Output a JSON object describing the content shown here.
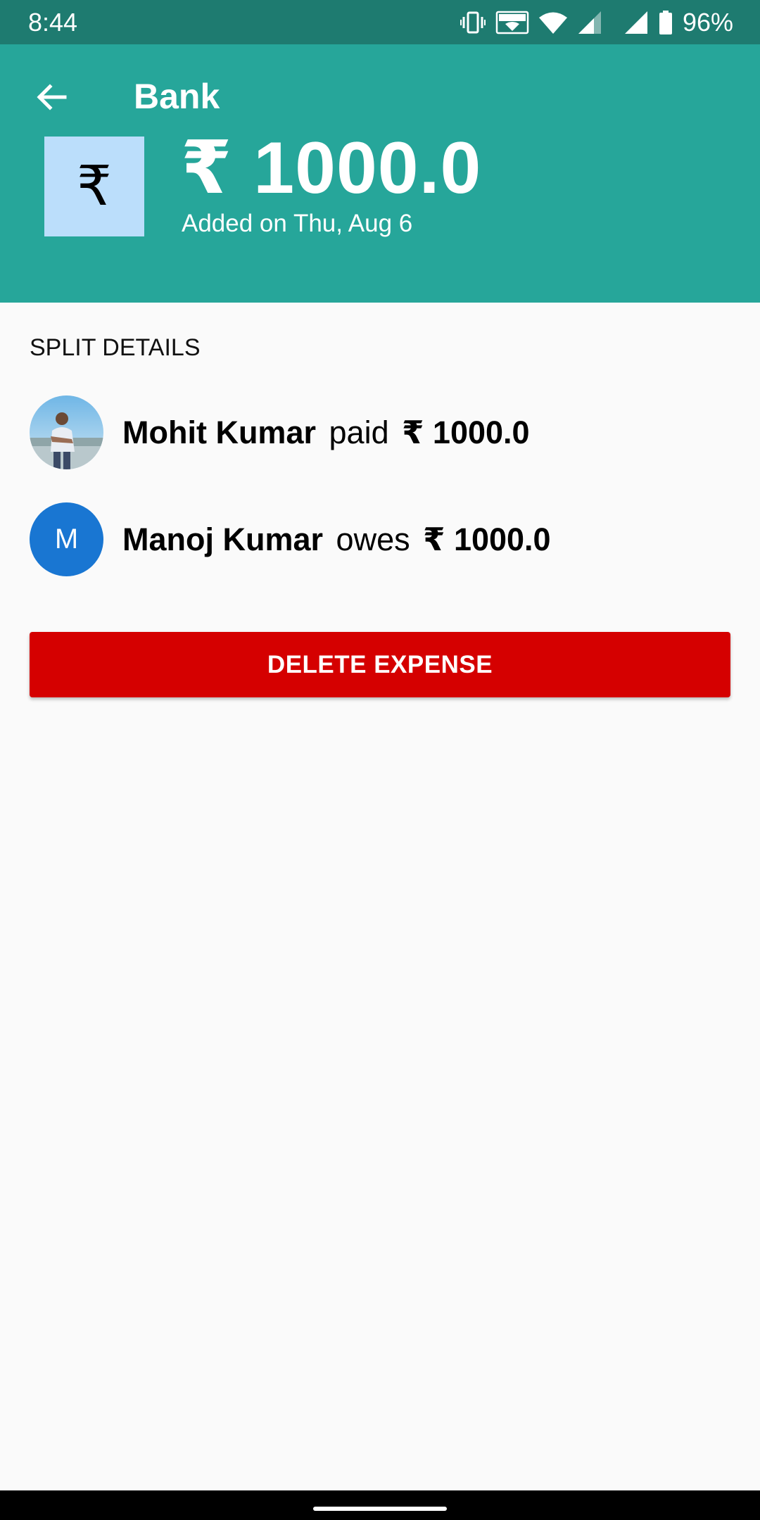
{
  "status_bar": {
    "time": "8:44",
    "battery": "96%",
    "icons": [
      "vibrate-icon",
      "vowifi-icon",
      "wifi-icon",
      "signal-icon",
      "signal-icon",
      "battery-icon"
    ]
  },
  "header": {
    "title": "Bank",
    "category_symbol": "₹",
    "amount": "₹ 1000.0",
    "added_on": "Added on Thu, Aug 6"
  },
  "split": {
    "section_title": "SPLIT DETAILS",
    "rows": [
      {
        "name": "Mohit Kumar",
        "verb": "paid",
        "amount": "₹ 1000.0",
        "avatar": "photo"
      },
      {
        "name": "Manoj Kumar",
        "verb": "owes",
        "amount": "₹ 1000.0",
        "avatar_letter": "M"
      }
    ]
  },
  "actions": {
    "delete_label": "DELETE EXPENSE"
  },
  "colors": {
    "status_bar": "#1e7b70",
    "app_bar": "#26a69a",
    "category_icon_bg": "#bbdefb",
    "avatar_bg": "#1976d2",
    "delete_button": "#d50000"
  }
}
